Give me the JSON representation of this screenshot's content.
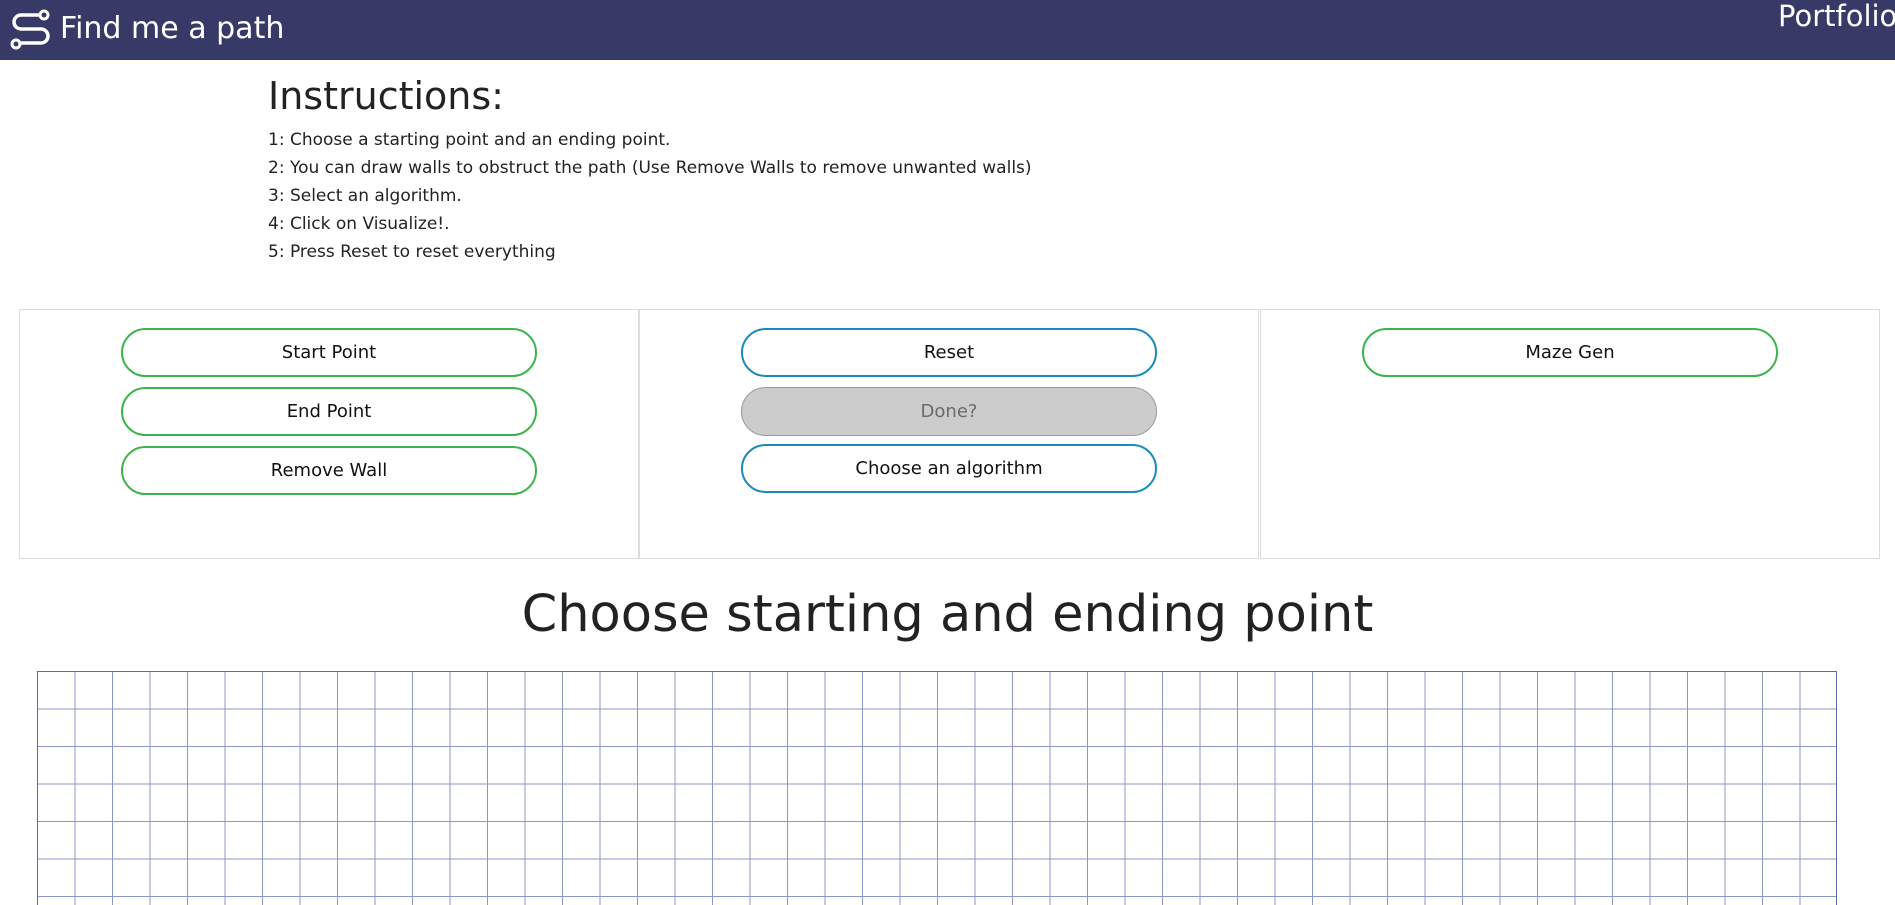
{
  "navbar": {
    "brand_icon": "route-icon",
    "brand_title": "Find me a path",
    "link_label": "Portfolio",
    "background_color": "#373a66"
  },
  "instructions": {
    "title": "Instructions:",
    "steps": [
      "1: Choose a starting point and an ending point.",
      "2: You can draw walls to obstruct the path (Use Remove Walls to remove unwanted walls)",
      "3: Select an algorithm.",
      "4: Click on Visualize!.",
      "5: Press Reset to reset everything"
    ]
  },
  "controls": {
    "start_point": "Start Point",
    "end_point": "End Point",
    "remove_wall": "Remove Wall",
    "reset": "Reset",
    "done": "Done?",
    "choose_algorithm": "Choose an algorithm",
    "maze_gen": "Maze Gen"
  },
  "status_heading": "Choose starting and ending point",
  "colors": {
    "green_border": "#3cb44b",
    "blue_border": "#1a8bb9",
    "disabled_bg": "#cccccc",
    "grid_line": "#8d97c6"
  }
}
